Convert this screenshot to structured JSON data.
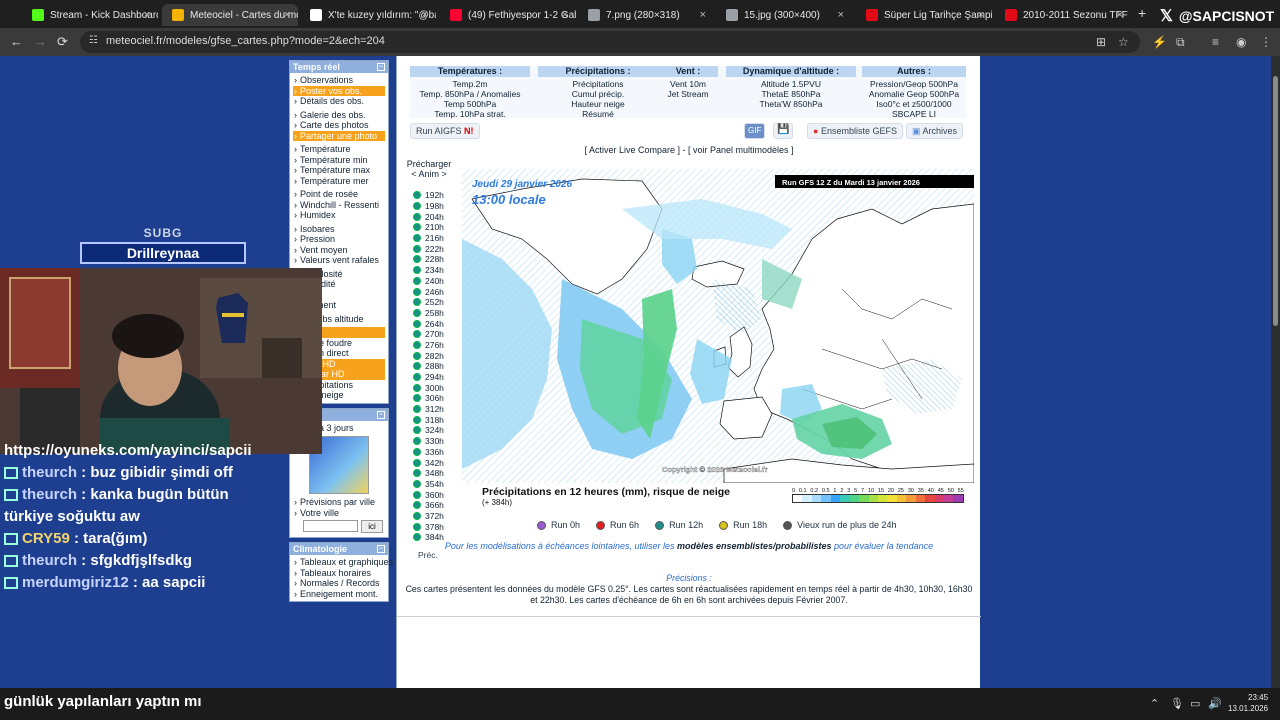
{
  "browser": {
    "tabs": [
      {
        "title": "Stream - Kick Dashboard",
        "color": "#53fc18",
        "active": false
      },
      {
        "title": "Meteociel - Cartes du mo",
        "color": "#f2b400",
        "active": true
      },
      {
        "title": "X'te kuzey yıldırım: \"@bar",
        "color": "#ffffff",
        "active": false
      },
      {
        "title": "(49) Fethiyespor 1-2 Galat",
        "color": "#ff0033",
        "active": false
      },
      {
        "title": "7.png (280×318)",
        "color": "#9aa0a6",
        "active": false
      },
      {
        "title": "15.jpg (300×400)",
        "color": "#9aa0a6",
        "active": false
      },
      {
        "title": "Süper Lig Tarihçe Şampiy",
        "color": "#e30a17",
        "active": false
      },
      {
        "title": "2010-2011 Sezonu TFF",
        "color": "#e30a17",
        "active": false
      }
    ],
    "new_tab": "+",
    "x_handle": "@SAPCISNOT",
    "url": "meteociel.fr/modeles/gfse_cartes.php?mode=2&ech=204"
  },
  "sidebar": {
    "temps_reel": {
      "title": "Temps réel",
      "groups": [
        [
          {
            "label": "Observations",
            "hi": false
          },
          {
            "label": "Poster vos obs.",
            "hi": true
          },
          {
            "label": "Détails des obs.",
            "hi": false
          }
        ],
        [
          {
            "label": "Galerie des obs.",
            "hi": false
          },
          {
            "label": "Carte des photos",
            "hi": false
          },
          {
            "label": "Partager une photo",
            "hi": true
          }
        ],
        [
          {
            "label": "Température",
            "hi": false
          },
          {
            "label": "Température min",
            "hi": false
          },
          {
            "label": "Température max",
            "hi": false
          },
          {
            "label": "Température mer",
            "hi": false
          }
        ],
        [
          {
            "label": "Point de rosée",
            "hi": false
          },
          {
            "label": "Windchill - Ressenti",
            "hi": false
          },
          {
            "label": "Humidex",
            "hi": false
          }
        ],
        [
          {
            "label": "Isobares",
            "hi": false
          },
          {
            "label": "Pression",
            "hi": false
          },
          {
            "label": "Vent moyen",
            "hi": false
          },
          {
            "label": "Valeurs vent rafales",
            "hi": false
          }
        ],
        [
          {
            "label": "Nébulosité",
            "hi": false
          },
          {
            "label": "Humidité",
            "hi": false
          },
          {
            "label": "24h",
            "hi": false
          },
          {
            "label": "eillement",
            "hi": false
          }
        ],
        [
          {
            "label": "age obs altitude",
            "hi": false
          }
        ],
        [
          {
            "label": "ite",
            "hi": true
          },
          {
            "label": "cts de foudre",
            "hi": false
          },
          {
            "label": "cts en direct",
            "hi": false
          },
          {
            "label": "Pluie HD",
            "hi": true
          },
          {
            "label": "l Radar HD",
            "hi": true
          },
          {
            "label": "précipitations",
            "hi": false
          },
          {
            "label": "pluie/neige",
            "hi": false
          }
        ]
      ]
    },
    "previsions": {
      "title": "ions",
      "subtitle": "ions à 3 jours",
      "ville_links": [
        "Prévisions par ville",
        "Votre ville"
      ],
      "button": "ici"
    },
    "climatologie": {
      "title": "Climatologie",
      "items": [
        "Tableaux et graphiques par villes",
        "Tableaux horaires",
        "Normales / Records",
        "Enneigement mont."
      ]
    }
  },
  "menu": {
    "columns": [
      {
        "head": "Températures :",
        "items": [
          "Temp.2m",
          "Temp. 850hPa / Anomalies",
          "Temp 500hPa",
          "Temp. 10hPa strat."
        ]
      },
      {
        "head": "Précipitations :",
        "items": [
          "Précipitations",
          "Cumul précip.",
          "Hauteur neige",
          "Résumé"
        ]
      },
      {
        "head": "Vent :",
        "items": [
          "",
          "Vent 10m",
          "Jet Stream"
        ]
      },
      {
        "head": "Dynamique d'altitude :",
        "items": [
          "",
          "Altitude 1.5PVU",
          "ThetaE 850hPa",
          "Theta'W 850hPa"
        ]
      },
      {
        "head": "Autres :",
        "items": [
          "Pression/Geop 500hPa",
          "Anomalie Geop 500hPa",
          "Iso0°c et z500/1000",
          "SBCAPE LI"
        ]
      }
    ],
    "run_aigfs": "Run AIGFS",
    "run_aigfs_badge": "N!",
    "ensemble": "Ensembliste GEFS",
    "archives": "Archives",
    "live_links": "[ Activer Live Compare ] - [ voir Panel multimodèles ]"
  },
  "anim": {
    "precharger": "Précharger",
    "anim": "< Anim >",
    "hours": [
      "192h",
      "198h",
      "204h",
      "210h",
      "216h",
      "222h",
      "228h",
      "234h",
      "240h",
      "246h",
      "252h",
      "258h",
      "264h",
      "270h",
      "276h",
      "282h",
      "288h",
      "294h",
      "300h",
      "306h",
      "312h",
      "318h",
      "324h",
      "330h",
      "336h",
      "342h",
      "348h",
      "354h",
      "360h",
      "366h",
      "372h",
      "378h",
      "384h"
    ],
    "prec_label": "Préc."
  },
  "map": {
    "date_line": "Jeudi 29 janvier 2026",
    "time_line": "13:00 locale",
    "run_banner": "Run GFS 12 Z du Mardi 13 janvier 2026",
    "copyright": "Copyright © 2026 Meteociel.fr",
    "legend_title": "Précipitations en 12 heures (mm), risque de neige",
    "legend_sub": "(+ 384h)",
    "scale_labels": [
      "0",
      "0.1",
      "0.2",
      "0.5",
      "1",
      "2",
      "3",
      "5",
      "7",
      "10",
      "15",
      "20",
      "25",
      "30",
      "35",
      "40",
      "45",
      "50",
      "55"
    ],
    "scale_colors": [
      "#ffffff",
      "#d6f0ff",
      "#a9dcff",
      "#73c2ff",
      "#3aa3ff",
      "#39c9b8",
      "#4fd48a",
      "#77dc5a",
      "#a6e048",
      "#d3e63c",
      "#f3e13a",
      "#f6c13a",
      "#f49a3a",
      "#ef6e3c",
      "#e5473f",
      "#d83a6a",
      "#c33c98",
      "#9f3bb0"
    ]
  },
  "runs": [
    {
      "label": "Run 0h",
      "color": "#9b59d0"
    },
    {
      "label": "Run 6h",
      "color": "#e02020"
    },
    {
      "label": "Run 12h",
      "color": "#1f8f8a"
    },
    {
      "label": "Run 18h",
      "color": "#d8c21a"
    },
    {
      "label": "Vieux run de plus de 24h",
      "color": "#555555"
    }
  ],
  "note": {
    "before": "Pour les modélisations à échéances lointaines, utiliser les ",
    "bold": "modèles ensemblistes/probabilistes",
    "after": " pour évaluer la tendance"
  },
  "precisions": {
    "head": "Précisions :",
    "text": "Ces cartes présentent les données du modèle GFS 0.25°. Les cartes sont réactualisées rapidement en temps réel à partir de 4h30, 10h30, 16h30 et 22h30. Les cartes d'échéance de 6h en 6h sont archivées depuis Février 2007."
  },
  "stream": {
    "badge_title": "SUBG",
    "badge_name": "Drillreynaa",
    "chat": [
      {
        "user": "",
        "text": "https://oyuneks.com/yayinci/sapcii"
      },
      {
        "user": "theurch",
        "text": " : buz gibidir şimdi off"
      },
      {
        "user": "theurch",
        "text": " : kanka bugün bütün"
      },
      {
        "user": "",
        "text": "türkiye soğuktu aw"
      },
      {
        "user": "CRY59",
        "text": " : tara(ğım)"
      },
      {
        "user": "theurch",
        "text": " : sfgkdfjşlfsdkg"
      },
      {
        "user": "merdumgiriz12",
        "text": " : aa sapcii"
      }
    ],
    "taskbar_chat": "günlük yapılanları yaptın mı"
  },
  "clock": {
    "time": "23:45",
    "date": "13.01.2026"
  }
}
